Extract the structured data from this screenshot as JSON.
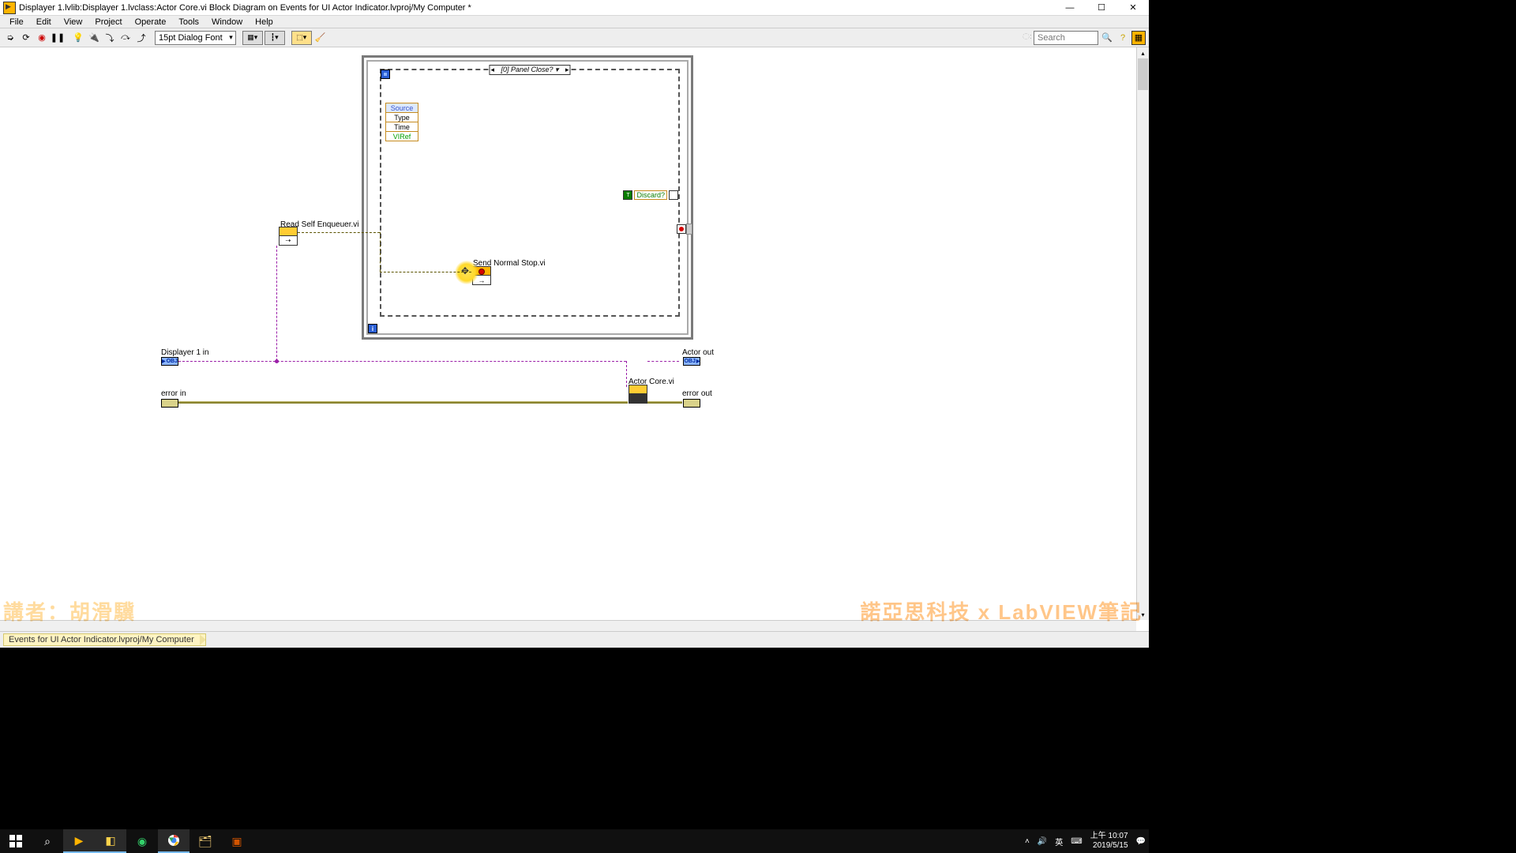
{
  "window": {
    "title": "Displayer 1.lvlib:Displayer 1.lvclass:Actor Core.vi Block Diagram on Events for UI Actor Indicator.lvproj/My Computer *"
  },
  "menu": {
    "file": "File",
    "edit": "Edit",
    "view": "View",
    "project": "Project",
    "operate": "Operate",
    "tools": "Tools",
    "window": "Window",
    "help": "Help"
  },
  "toolbar": {
    "font": "15pt Dialog Font",
    "search_placeholder": "Search"
  },
  "diagram": {
    "event_case": "[0] Panel Close? ▾",
    "data_nodes": {
      "source": "Source",
      "type": "Type",
      "time": "Time",
      "viref": "VIRef"
    },
    "discard": "Discard?",
    "read_self_enqueuer": "Read Self Enqueuer.vi",
    "send_normal_stop": "Send Normal Stop.vi",
    "actor_core": "Actor Core.vi",
    "displayer_in": "Displayer 1 in",
    "actor_out": "Actor out",
    "error_in": "error in",
    "error_out": "error out",
    "obj_txt": "OBJ",
    "i_txt": "i"
  },
  "status": {
    "crumb": "Events for UI Actor Indicator.lvproj/My Computer"
  },
  "tray": {
    "ime": "英",
    "time": "上午 10:07",
    "date": "2019/5/15"
  },
  "watermark": {
    "left": "講者：胡滑驥",
    "right": "諾亞思科技 x LabVIEW筆記"
  }
}
